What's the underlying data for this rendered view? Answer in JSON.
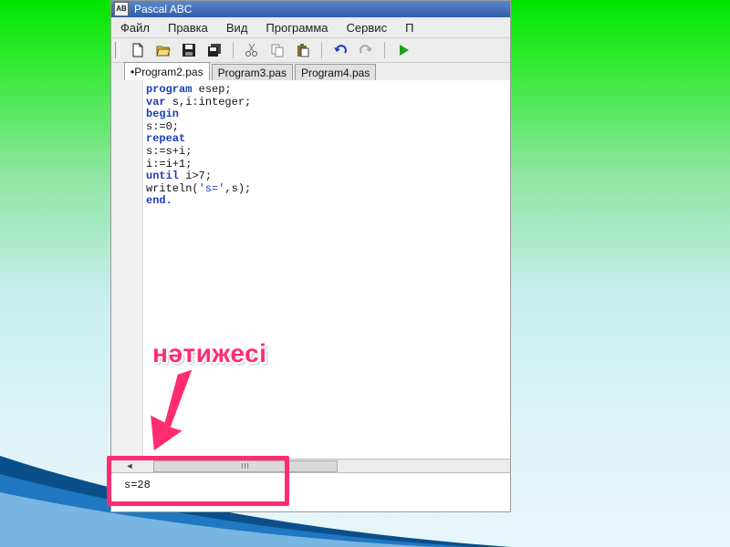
{
  "window": {
    "title": "Pascal ABC",
    "app_icon_text": "AB"
  },
  "menu": [
    "Файл",
    "Правка",
    "Вид",
    "Программа",
    "Сервис",
    "П"
  ],
  "toolbar": {
    "icons": [
      "new-file-icon",
      "open-folder-icon",
      "save-icon",
      "save-all-icon",
      "cut-icon",
      "copy-icon",
      "paste-icon",
      "undo-icon",
      "redo-icon",
      "run-icon"
    ]
  },
  "tabs": [
    {
      "label": "•Program2.pas",
      "active": true
    },
    {
      "label": "Program3.pas",
      "active": false
    },
    {
      "label": "Program4.pas",
      "active": false
    }
  ],
  "code_lines": [
    [
      {
        "t": "program",
        "kw": true
      },
      {
        "t": " esep;",
        "kw": false
      }
    ],
    [
      {
        "t": "var",
        "kw": true
      },
      {
        "t": " s,i:integer;",
        "kw": false
      }
    ],
    [
      {
        "t": "begin",
        "kw": true
      }
    ],
    [
      {
        "t": "s:=0;",
        "kw": false
      }
    ],
    [
      {
        "t": "repeat",
        "kw": true
      }
    ],
    [
      {
        "t": "s:=s+i;",
        "kw": false
      }
    ],
    [
      {
        "t": "i:=i+1;",
        "kw": false
      }
    ],
    [
      {
        "t": "until",
        "kw": true
      },
      {
        "t": " i>7;",
        "kw": false
      }
    ],
    [
      {
        "t": "writeln(",
        "kw": false
      },
      {
        "t": "'s='",
        "str": true
      },
      {
        "t": ",s);",
        "kw": false
      }
    ],
    [
      {
        "t": "end.",
        "kw": true
      }
    ]
  ],
  "scrollbar": {
    "thumb_grip": "III"
  },
  "output": {
    "text": "s=28"
  },
  "annotation": {
    "label": "нәтижесі",
    "color": "#ff2d6f"
  }
}
